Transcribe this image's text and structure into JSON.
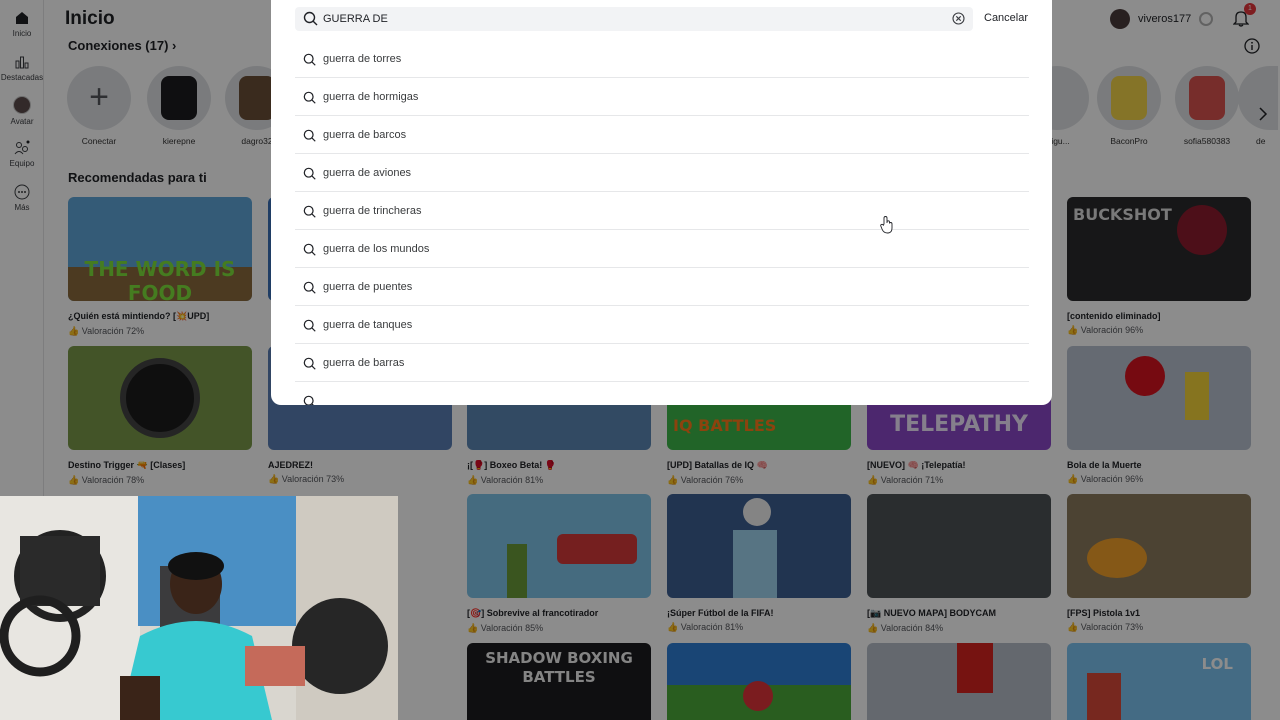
{
  "nav": {
    "items": [
      {
        "label": "Inicio",
        "icon": "home-icon"
      },
      {
        "label": "Destacadas",
        "icon": "charts-icon"
      },
      {
        "label": "Avatar",
        "icon": "avatar-icon"
      },
      {
        "label": "Equipo",
        "icon": "party-icon"
      },
      {
        "label": "Más",
        "icon": "more-icon"
      }
    ]
  },
  "header": {
    "title": "Inicio",
    "username": "viveros177",
    "notification_count": "1"
  },
  "connections": {
    "title": "Conexiones (17)",
    "friends": [
      {
        "name": "Conectar"
      },
      {
        "name": "kierepne"
      },
      {
        "name": "dagro32"
      },
      {
        "name": "migu..."
      },
      {
        "name": "BaconPro"
      },
      {
        "name": "sofia580383"
      },
      {
        "name": "de"
      }
    ]
  },
  "recommended": {
    "title": "Recomendadas para ti",
    "row1": [
      {
        "name": "¿Quién está mintiendo? [💥UPD]",
        "rating": "Valoración 72%",
        "thumb_text": "THE WORD IS FOOD"
      },
      {
        "name": "[contenido eliminado]",
        "rating": "Valoración 96%",
        "thumb_text": "BUCKSHOT"
      }
    ],
    "row2": [
      {
        "name": "Destino Trigger 🔫 [Clases]",
        "rating": "Valoración 78%"
      },
      {
        "name": "AJEDREZ!",
        "rating": "Valoración 73%"
      },
      {
        "name": "¡[🥊] Boxeo Beta! 🥊",
        "rating": "Valoración 81%"
      },
      {
        "name": "[UPD] Batallas de IQ 🧠",
        "rating": "Valoración 76%",
        "thumb_text": "IQ BATTLES"
      },
      {
        "name": "[NUEVO] 🧠 ¡Telepatía!",
        "rating": "Valoración 71%",
        "thumb_text": "TELEPATHY"
      },
      {
        "name": "Bola de la Muerte",
        "rating": "Valoración 96%"
      }
    ],
    "row3": [
      {
        "name": "[🎯] Sobrevive al francotirador",
        "rating": "Valoración 85%"
      },
      {
        "name": "¡Súper Fútbol de la FIFA!",
        "rating": "Valoración 81%"
      },
      {
        "name": "[📷 NUEVO MAPA] BODYCAM",
        "rating": "Valoración 84%"
      },
      {
        "name": "[FPS] Pistola 1v1",
        "rating": "Valoración 73%"
      }
    ],
    "row4": [
      {
        "thumb_text": "SHADOW BOXING BATTLES"
      },
      {
        "thumb_text": ""
      },
      {
        "thumb_text": ""
      },
      {
        "thumb_text": "LOL"
      }
    ]
  },
  "search": {
    "query": "GUERRA DE ",
    "cancel_label": "Cancelar",
    "suggestions": [
      "guerra de torres",
      "guerra de hormigas",
      "guerra de barcos",
      "guerra de aviones",
      "guerra de trincheras",
      "guerra de los mundos",
      "guerra de puentes",
      "guerra de tanques",
      "guerra de barras"
    ]
  }
}
